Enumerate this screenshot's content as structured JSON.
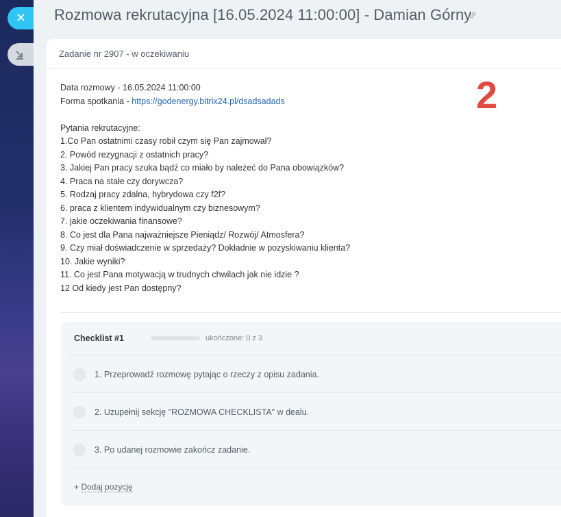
{
  "slider": {
    "close_icon": "close-icon",
    "minimize_icon": "minimize-arrow-icon"
  },
  "page": {
    "title": "Rozmowa rekrutacyjna [16.05.2024 11:00:00] - Damian Górny",
    "link_icon": "link-icon"
  },
  "task": {
    "header": "Zadanie nr 2907 - w oczekiwaniu",
    "date_line": "Data rozmowy - 16.05.2024 11:00:00",
    "meeting_prefix": "Forma spotkania - ",
    "meeting_link": "https://godenergy.bitrix24.pl/dsadsadads",
    "questions_heading": "Pytania rekrutacyjne:",
    "questions": [
      "1.Co Pan ostatnimi czasy robił czym się Pan zajmował?",
      "2. Powód rezygnacji z ostatnich pracy?",
      "3. Jakiej Pan pracy szuka bądź co miało by należeć do Pana obowiązków?",
      "4. Praca na stałe czy dorywcza?",
      "5. Rodzaj pracy zdalna, hybrydowa czy f2f?",
      "6. praca z klientem indywidualnym czy biznesowym?",
      "7. jakie oczekiwania finansowe?",
      "8. Co jest dla Pana najważniejsze Pieniądz/ Rozwój/ Atmosfera?",
      "9. Czy miał doświadczenie w sprzedaży? Dokładnie w pozyskiwaniu klienta?",
      "10. Jakie wyniki?",
      "11. Co jest Pana motywacją w trudnych chwilach jak nie idzie ?",
      "12 Od kiedy jest Pan dostępny?"
    ]
  },
  "annotation": {
    "marker": "2"
  },
  "checklist": {
    "title": "Checklist #1",
    "progress": 0,
    "status": "ukończone: 0 z 3",
    "items": [
      {
        "label": "1. Przeprowadź rozmowę pytając o rzeczy z opisu zadania.",
        "checked": false
      },
      {
        "label": "2. Uzupełnij sekcję \"ROZMOWA CHECKLISTA\" w dealu.",
        "checked": false
      },
      {
        "label": "3. Po udanej rozmowie zakończ zadanie.",
        "checked": false
      }
    ],
    "add_prefix": "+ ",
    "add_label": "Dodaj pozycję"
  },
  "colors": {
    "accent": "#2fc6f6",
    "link": "#2067b0",
    "marker": "#e24a44"
  }
}
